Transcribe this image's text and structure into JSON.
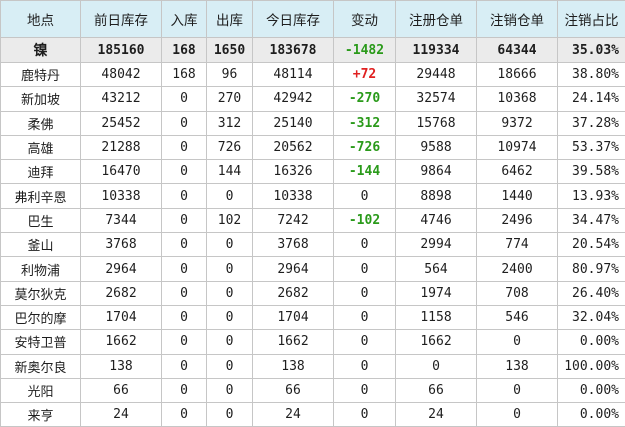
{
  "columns": [
    "地点",
    "前日库存",
    "入库",
    "出库",
    "今日库存",
    "变动",
    "注册仓单",
    "注销仓单",
    "注销占比"
  ],
  "summary": [
    "镍",
    "185160",
    "168",
    "1650",
    "183678",
    "-1482",
    "119334",
    "64344",
    "35.03%"
  ],
  "summary_change_dir": "down",
  "rows": [
    {
      "cells": [
        "鹿特丹",
        "48042",
        "168",
        "96",
        "48114",
        "+72",
        "29448",
        "18666",
        "38.80%"
      ],
      "dir": "up"
    },
    {
      "cells": [
        "新加坡",
        "43212",
        "0",
        "270",
        "42942",
        "-270",
        "32574",
        "10368",
        "24.14%"
      ],
      "dir": "down"
    },
    {
      "cells": [
        "柔佛",
        "25452",
        "0",
        "312",
        "25140",
        "-312",
        "15768",
        "9372",
        "37.28%"
      ],
      "dir": "down"
    },
    {
      "cells": [
        "高雄",
        "21288",
        "0",
        "726",
        "20562",
        "-726",
        "9588",
        "10974",
        "53.37%"
      ],
      "dir": "down"
    },
    {
      "cells": [
        "迪拜",
        "16470",
        "0",
        "144",
        "16326",
        "-144",
        "9864",
        "6462",
        "39.58%"
      ],
      "dir": "down"
    },
    {
      "cells": [
        "弗利辛恩",
        "10338",
        "0",
        "0",
        "10338",
        "0",
        "8898",
        "1440",
        "13.93%"
      ],
      "dir": "none"
    },
    {
      "cells": [
        "巴生",
        "7344",
        "0",
        "102",
        "7242",
        "-102",
        "4746",
        "2496",
        "34.47%"
      ],
      "dir": "down"
    },
    {
      "cells": [
        "釜山",
        "3768",
        "0",
        "0",
        "3768",
        "0",
        "2994",
        "774",
        "20.54%"
      ],
      "dir": "none"
    },
    {
      "cells": [
        "利物浦",
        "2964",
        "0",
        "0",
        "2964",
        "0",
        "564",
        "2400",
        "80.97%"
      ],
      "dir": "none"
    },
    {
      "cells": [
        "莫尔狄克",
        "2682",
        "0",
        "0",
        "2682",
        "0",
        "1974",
        "708",
        "26.40%"
      ],
      "dir": "none"
    },
    {
      "cells": [
        "巴尔的摩",
        "1704",
        "0",
        "0",
        "1704",
        "0",
        "1158",
        "546",
        "32.04%"
      ],
      "dir": "none"
    },
    {
      "cells": [
        "安特卫普",
        "1662",
        "0",
        "0",
        "1662",
        "0",
        "1662",
        "0",
        "0.00%"
      ],
      "dir": "none"
    },
    {
      "cells": [
        "新奥尔良",
        "138",
        "0",
        "0",
        "138",
        "0",
        "0",
        "138",
        "100.00%"
      ],
      "dir": "none"
    },
    {
      "cells": [
        "光阳",
        "66",
        "0",
        "0",
        "66",
        "0",
        "66",
        "0",
        "0.00%"
      ],
      "dir": "none"
    },
    {
      "cells": [
        "来亨",
        "24",
        "0",
        "0",
        "24",
        "0",
        "24",
        "0",
        "0.00%"
      ],
      "dir": "none"
    }
  ],
  "colors": {
    "header_bg": "#d8eef5",
    "summary_bg": "#ebebeb",
    "up": "#e02020",
    "down": "#2a9a1a",
    "grid": "#c6c6c6"
  }
}
